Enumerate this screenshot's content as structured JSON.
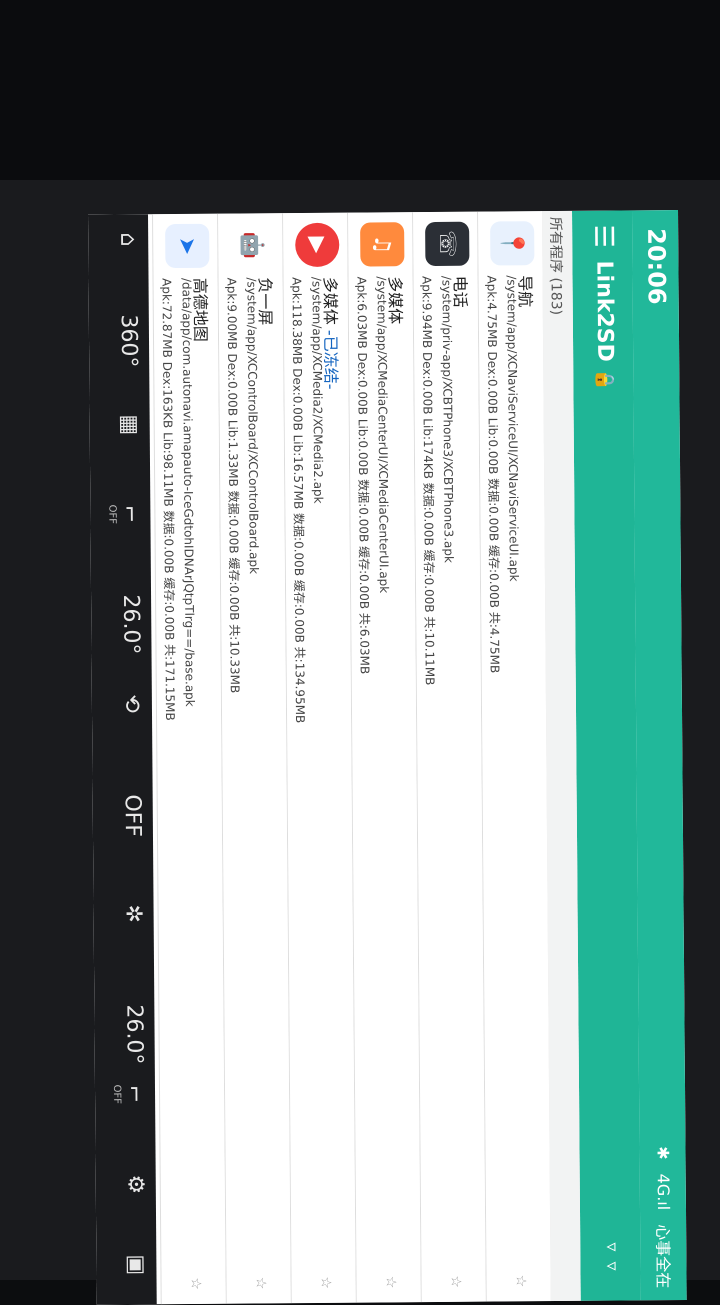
{
  "status": {
    "time": "20:06",
    "net": "4G.ıl",
    "carrier": "心事全在",
    "bt": "✱"
  },
  "appbar": {
    "title": "Link2SD"
  },
  "section": {
    "label": "所有程序 (183)"
  },
  "apps": [
    {
      "name": "导航",
      "tag": "",
      "path": "/system/app/XCNaviServiceUI/XCNaviServiceUI.apk",
      "meta": "Apk:4.75MB Dex:0.00B Lib:0.00B 数据:0.00B 缓存:0.00B 共:4.75MB",
      "icon_color": "#1e88e5",
      "glyph": "📍"
    },
    {
      "name": "电话",
      "tag": "",
      "path": "/system/priv-app/XCBTPhone3/XCBTPhone3.apk",
      "meta": "Apk:9.94MB Dex:0.00B Lib:174KB 数据:0.00B 缓存:0.00B 共:10.11MB",
      "icon_color": "#2b2f36",
      "glyph": "☏"
    },
    {
      "name": "多媒体",
      "tag": "",
      "path": "/system/app/XCMediaCenterUI/XCMediaCenterUI.apk",
      "meta": "Apk:6.03MB Dex:0.00B Lib:0.00B 数据:0.00B 缓存:0.00B 共:6.03MB",
      "icon_color": "#ff8a3d",
      "glyph": "♫"
    },
    {
      "name": "多媒体 ",
      "tag": "-已冻结-",
      "path": "/system/app/XCMedia2/XCMedia2.apk",
      "meta": "Apk:118.38MB Dex:0.00B Lib:16.57MB 数据:0.00B 缓存:0.00B 共:134.95MB",
      "icon_color": "#ef3b3b",
      "glyph": "▶"
    },
    {
      "name": "负一屏",
      "tag": "",
      "path": "/system/app/XCControlBoard/XCControlBoard.apk",
      "meta": "Apk:9.00MB Dex:0.00B Lib:1.33MB 数据:0.00B 缓存:0.00B 共:10.33MB",
      "icon_color": "#7cc142",
      "glyph": "🤖"
    },
    {
      "name": "高德地图",
      "tag": "",
      "path": "/data/app/com.autonavi.amapauto-IceGdtohIDNArJQtpTlrg==/base.apk",
      "meta": "Apk:72.87MB Dex:163KB Lib:98.11MB 数据:0.00B 缓存:0.00B 共:171.15MB",
      "icon_color": "#1b74e8",
      "glyph": "➤"
    }
  ],
  "carbar": {
    "temp_left": "26.0",
    "fan_left": "OFF",
    "mode": "OFF",
    "temp_right": "26.0",
    "fan_right": "OFF",
    "view360": "360"
  }
}
